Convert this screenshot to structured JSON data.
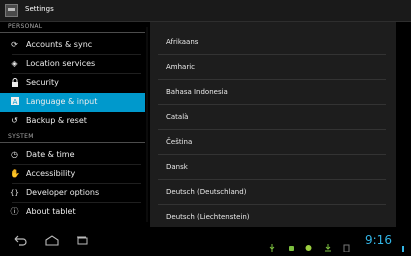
{
  "titlebar": {
    "title": "Settings"
  },
  "sidebar": {
    "sections": [
      {
        "header": "PERSONAL"
      },
      {
        "header": "SYSTEM"
      }
    ],
    "items": [
      {
        "label": "Accounts & sync",
        "icon": "sync-icon"
      },
      {
        "label": "Location services",
        "icon": "location-icon"
      },
      {
        "label": "Security",
        "icon": "lock-icon"
      },
      {
        "label": "Language & input",
        "icon": "language-icon",
        "selected": true
      },
      {
        "label": "Backup & reset",
        "icon": "backup-icon"
      },
      {
        "label": "Date & time",
        "icon": "clock-icon"
      },
      {
        "label": "Accessibility",
        "icon": "hand-icon"
      },
      {
        "label": "Developer options",
        "icon": "braces-icon"
      },
      {
        "label": "About tablet",
        "icon": "info-icon"
      }
    ]
  },
  "languages": [
    "Afrikaans",
    "Amharic",
    "Bahasa Indonesia",
    "Català",
    "Čeština",
    "Dansk",
    "Deutsch (Deutschland)",
    "Deutsch (Liechtenstein)"
  ],
  "statusbar": {
    "time": "9:16"
  },
  "colors": {
    "accent": "#0099cc",
    "clock": "#33b5e5",
    "panel": "#1d1d1d"
  }
}
